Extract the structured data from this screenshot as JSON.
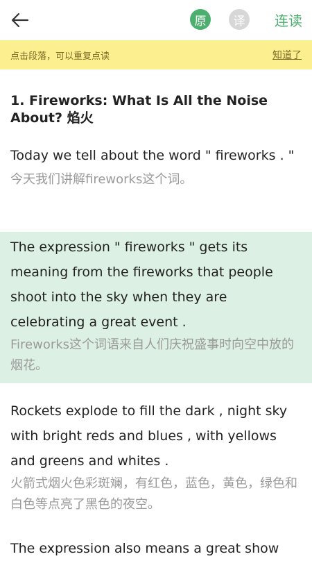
{
  "header": {
    "back_icon": "arrow-left-icon",
    "original_label": "原",
    "translate_label": "译",
    "continuous_label": "连读",
    "accent_color": "#4caf6e"
  },
  "notice": {
    "text": "点击段落，可以重复点读",
    "dismiss_label": "知道了",
    "background": "#fbef8f"
  },
  "article": {
    "title": "1. Fireworks: What Is All the Noise About? 焰火",
    "paragraphs": [
      {
        "en": "Today we tell about the word \" fireworks . \"",
        "zh": "今天我们讲解fireworks这个词。"
      },
      {
        "en": "The expression \" fireworks \" gets its meaning from the fireworks that people shoot into the sky when they are celebrating a great event .",
        "zh": "Fireworks这个词语来自人们庆祝盛事时向空中放的烟花。",
        "highlight_color": "#dcf1e3"
      },
      {
        "en": "Rockets explode to fill the dark , night sky with bright reds and blues , with yellows and greens and whites .",
        "zh": "火箭式烟火色彩斑斓，有红色，蓝色，黄色，绿色和白色等点亮了黑色的夜空。"
      },
      {
        "en": "The expression also means a great show"
      }
    ]
  }
}
